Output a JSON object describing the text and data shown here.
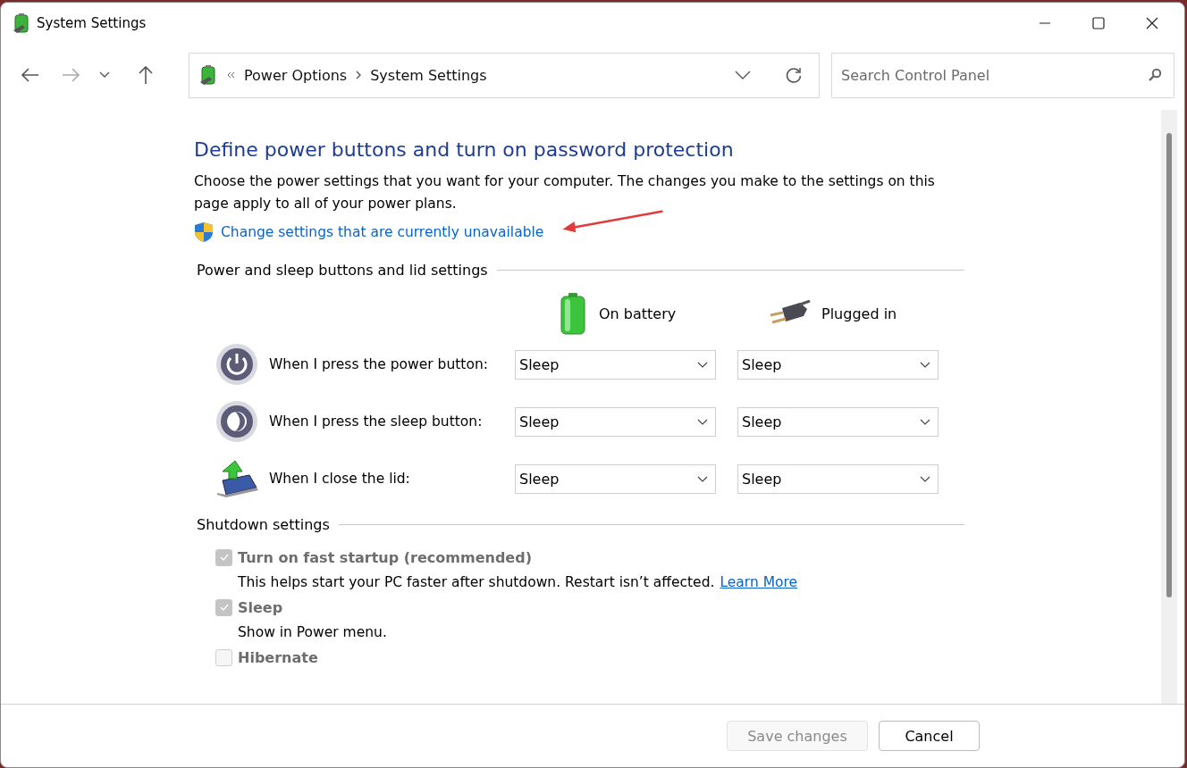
{
  "window": {
    "title": "System Settings"
  },
  "nav_buttons": [
    {
      "kind": "back",
      "disabled": false
    },
    {
      "kind": "forward",
      "disabled": true
    },
    {
      "kind": "recent",
      "disabled": false
    },
    {
      "kind": "up",
      "disabled": false
    }
  ],
  "address": {
    "crumbs": [
      "Power Options",
      "System Settings"
    ]
  },
  "search": {
    "placeholder": "Search Control Panel"
  },
  "heading": "Define power buttons and turn on password protection",
  "description": "Choose the power settings that you want for your computer. The changes you make to the settings on this page apply to all of your power plans.",
  "link": "Change settings that are currently unavailable",
  "buttons_section": {
    "title": "Power and sleep buttons and lid settings",
    "columns": [
      {
        "kind": "battery",
        "label": "On battery"
      },
      {
        "kind": "plug",
        "label": "Plugged in"
      }
    ],
    "rows": [
      {
        "kind": "power",
        "label": "When I press the power button:",
        "values": [
          "Sleep",
          "Sleep"
        ]
      },
      {
        "kind": "sleep",
        "label": "When I press the sleep button:",
        "values": [
          "Sleep",
          "Sleep"
        ]
      },
      {
        "kind": "lid",
        "label": "When I close the lid:",
        "values": [
          "Sleep",
          "Sleep"
        ]
      }
    ]
  },
  "shutdown_section": {
    "title": "Shutdown settings",
    "options": [
      {
        "label": "Turn on fast startup (recommended)",
        "checked": true,
        "disabled": true,
        "description": "This helps start your PC faster after shutdown. Restart isn’t affected.",
        "link": "Learn More"
      },
      {
        "label": "Sleep",
        "checked": true,
        "disabled": true,
        "description": "Show in Power menu."
      },
      {
        "label": "Hibernate",
        "checked": false,
        "disabled": true
      }
    ]
  },
  "footer": {
    "buttons": [
      {
        "label": "Save changes",
        "disabled": true
      },
      {
        "label": "Cancel",
        "disabled": false
      }
    ]
  }
}
